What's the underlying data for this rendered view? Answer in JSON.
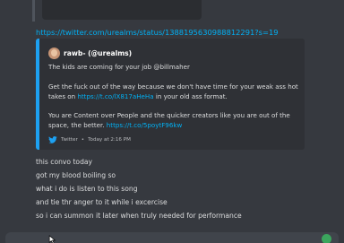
{
  "message": {
    "link_url": "https://twitter.com/urealms/status/1388195630988812291?s=19",
    "lines": [
      "this convo today",
      "got my blood boiling so",
      "what i do is listen to this song",
      "and tie thr anger to it while i excercise",
      "so i can summon it later when truly needed for performance"
    ]
  },
  "embed": {
    "author": "rawb- (@urealms)",
    "paragraph_1": "The kids are coming for your job @billmaher",
    "paragraph_2_start": "Get the fuck out of the way because we don't have time for your weak ass hot takes on ",
    "paragraph_2_link": "https://t.co/lX817aHeHa",
    "paragraph_2_end": " in your old ass format.",
    "paragraph_3_start": "You are Content over People and the quicker creators like you are out of the space, the better. ",
    "paragraph_3_link": "https://t.co/5poytF96kw",
    "footer_source": "Twitter",
    "footer_sep": "•",
    "footer_time": "Today at 2:16 PM",
    "accent_color": "#1da1f2"
  },
  "icons": {
    "footer": "twitter-bird-icon",
    "composer_right": "emoji-icon"
  }
}
